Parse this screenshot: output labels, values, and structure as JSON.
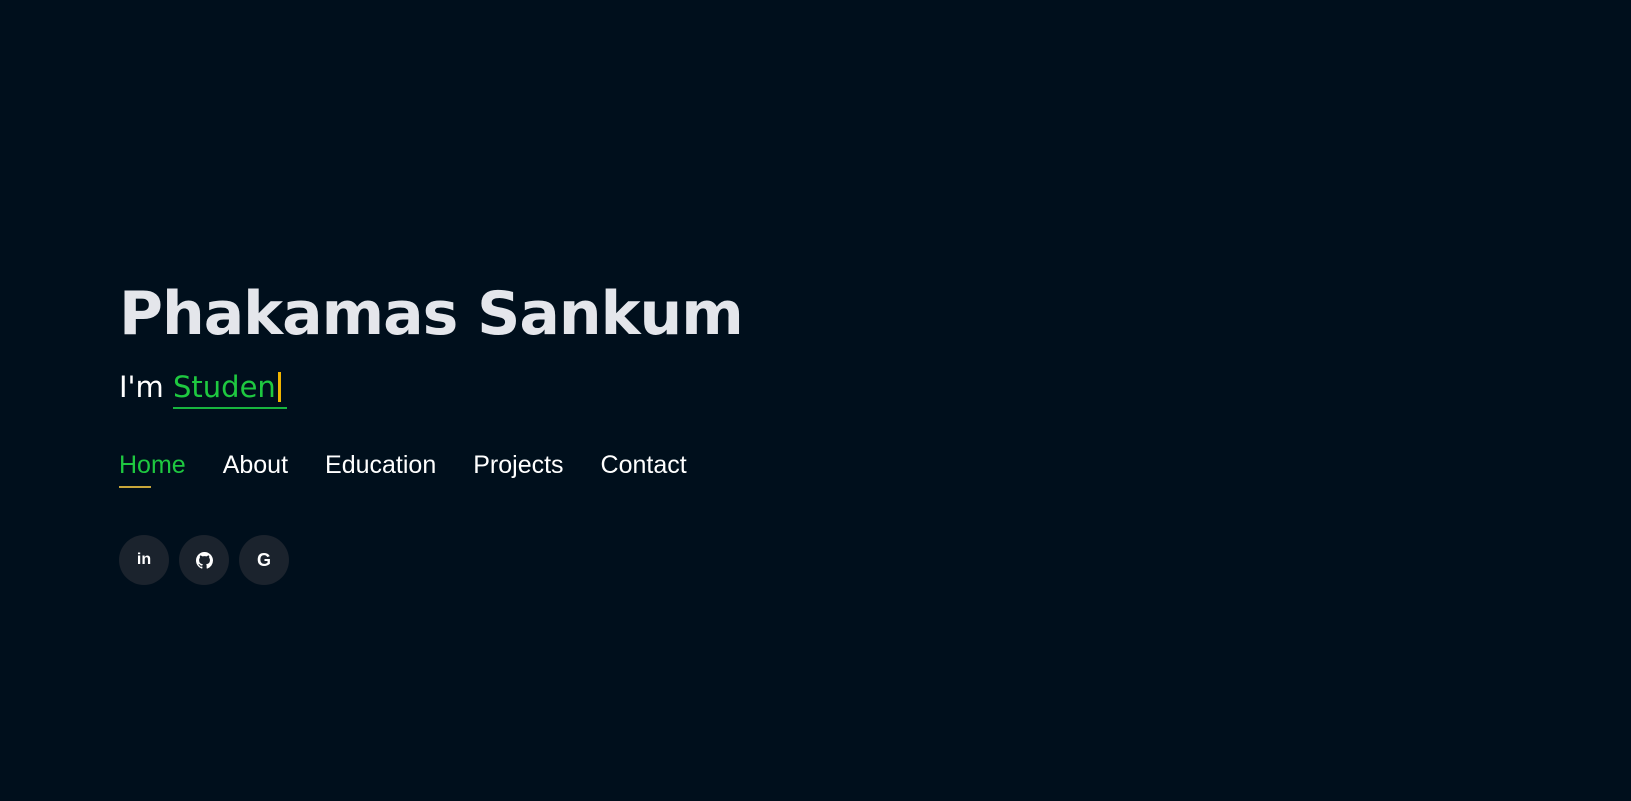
{
  "hero": {
    "name": "Phakamas Sankum",
    "tagline_prefix": "I'm",
    "typed_text": "Studen"
  },
  "nav": {
    "items": [
      {
        "label": "Home",
        "active": true
      },
      {
        "label": "About",
        "active": false
      },
      {
        "label": "Education",
        "active": false
      },
      {
        "label": "Projects",
        "active": false
      },
      {
        "label": "Contact",
        "active": false
      }
    ]
  },
  "socials": [
    {
      "icon": "linkedin-icon",
      "glyph": "in"
    },
    {
      "icon": "github-icon"
    },
    {
      "icon": "google-icon",
      "glyph": "G"
    }
  ],
  "colors": {
    "background": "#000f1c",
    "accent_green": "#1ec840",
    "cursor_yellow": "#f0b400",
    "active_underline": "#c8a63a",
    "social_bg": "#1b232d"
  }
}
